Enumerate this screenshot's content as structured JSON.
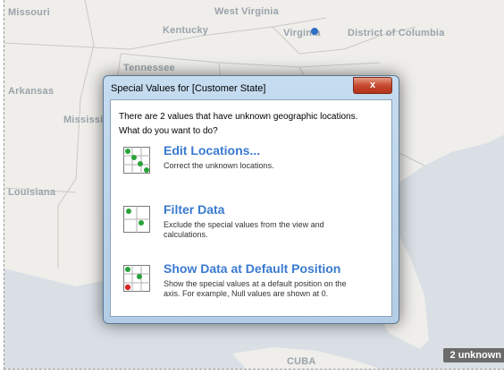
{
  "map": {
    "labels": {
      "missouri": "Missouri",
      "west_virginia": "West Virginia",
      "kentucky": "Kentucky",
      "virginia": "Virginia",
      "district_of_columbia": "District of Columbia",
      "tennessee": "Tennessee",
      "arkansas": "Arkansas",
      "mississippi": "Mississi",
      "louisiana": "Louisiana",
      "cuba": "CUBA"
    },
    "unknown_badge": "2 unknown",
    "colors": {
      "point": "#2f6fc4",
      "badge": "#6b6b6b"
    }
  },
  "dialog": {
    "title": "Special Values for [Customer State]",
    "close_label": "x",
    "intro_line1": "There are 2 values that have unknown geographic locations.",
    "intro_line2": "What do you want to do?",
    "options": [
      {
        "title": "Edit Locations...",
        "description": "Correct the unknown locations.",
        "icon": "edit-locations-icon"
      },
      {
        "title": "Filter Data",
        "description": "Exclude the special values from the view and calculations.",
        "icon": "filter-data-icon"
      },
      {
        "title": "Show Data at Default Position",
        "description": "Show the special values at a default position on the axis. For example, Null values are shown at 0.",
        "icon": "default-position-icon"
      }
    ],
    "colors": {
      "accent": "#3a7ad0"
    }
  }
}
